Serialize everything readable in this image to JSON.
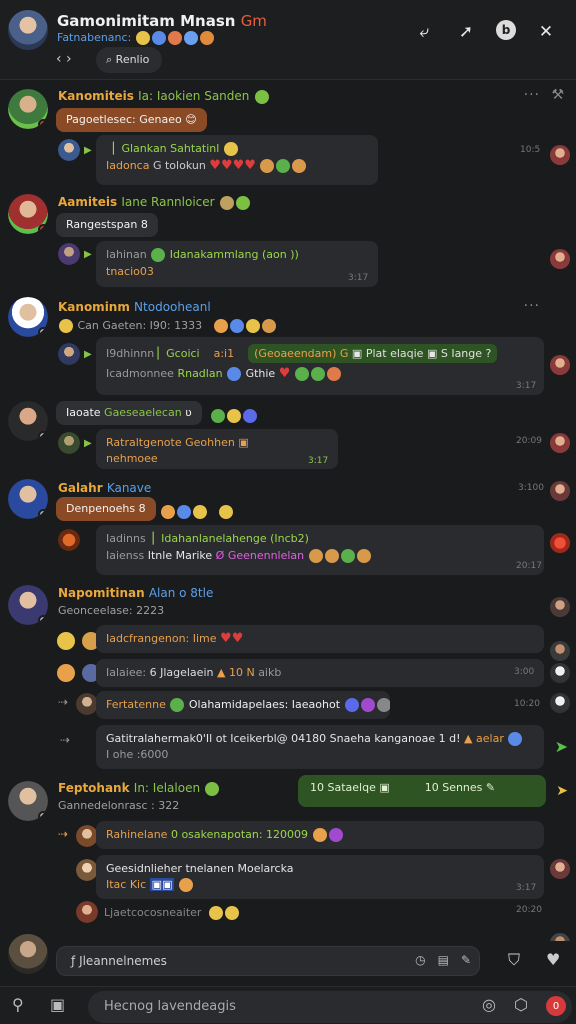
{
  "header": {
    "title": "Gamonimitam Mnasn",
    "title_tag": "Gm",
    "subtitle": "Fatnabenanc:",
    "search_label": "Renlio",
    "back_icon": "chevron-left-icon",
    "icons": [
      "share-icon",
      "forward-icon",
      "info-icon",
      "close-icon"
    ]
  },
  "messages": [
    {
      "name": "Kanomiteis",
      "name_extra": "Ia: Iaokien Sanden",
      "name_color": "#e8a83c",
      "pill": "Pagoetlesec: Genaeo",
      "pill_emoji": "😊",
      "bubble_line1": "Glankan Sahtatinl",
      "bubble_line2": "G tolokun",
      "bubble_prefix": "Iadonca",
      "time": "10:5"
    },
    {
      "name": "Aamiteis",
      "name_extra": "Iane Rannloicer",
      "name_color": "#e8a83c",
      "pill": "Rangestspan",
      "pill_emoji": "8",
      "bubble_prefix": "Iahinan",
      "bubble_line1": "Idanakammlang (aon ))",
      "bubble_line2": "tnacio03",
      "time": "3:17"
    },
    {
      "name": "Kanominm",
      "name_extra": "Ntodooheanl",
      "name_color": "#5aa0e8",
      "meta": "Can Gaeten: I90: 1333",
      "bubble_prefix": "I9dhinnn",
      "bubble_line1": "Gcoici",
      "bubble_mid": "a:i1",
      "bubble_green": "(Geoaeendam) G",
      "bubble_tail": "Plat elaqie",
      "bubble_tail2": "S Iange ?",
      "bubble_line2_prefix": "Icadmonnee",
      "bubble_line2": "Rnadlan",
      "bubble_line2b": "Gthie",
      "time": "3:17"
    },
    {
      "name": "Iaoate",
      "name_extra": "Gaeseaelecan",
      "name_color": "#d8d8d8",
      "bubble_line1": "Ratraltgenote Geohhen",
      "bubble_line2": "nehmoee",
      "time": "3:17",
      "time2": "20:09"
    },
    {
      "name": "Galahr",
      "name_extra": "Kanave",
      "name_color": "#e8a83c",
      "pill": "Denpenoehs",
      "pill_emoji": "8",
      "bubble_prefix": "Iadinns",
      "bubble_line1": "Idahanlanelahenge (Incb2)",
      "bubble_line2_prefix": "Iaienss",
      "bubble_line2": "Itnle Marike",
      "bubble_line2b": "Geenennlelan",
      "time": "20:17",
      "time2": "3:100"
    },
    {
      "name": "Napomitinan",
      "name_extra": "Alan o 8tle",
      "name_color": "#e8a83c",
      "meta": "Geonceelase: 2223",
      "row1": "Iadcfrangenon: Iime",
      "row2_prefix": "Ialaiee:",
      "row2": "6 Jlagelaein",
      "row2_mid": "10 N",
      "row2_tail": "aikb",
      "row3": "Fertatenne",
      "row3_mid": "Olahamidapelaes: Iaeaohot",
      "row4": "Gatitralahermak0'Il ot Iceikerbl@ 04180 Snaeha kanganoae 1 d!",
      "row4_tail": "aelar",
      "row4_line2": "I ohe :6000",
      "time_a": "3:00",
      "time_b": "10:20"
    },
    {
      "name": "Feptohank",
      "name_extra": "In: Ielaloen",
      "name_color": "#e8a83c",
      "meta": "Gannedelonrasc : 322",
      "green_left": "10 Sataelqe",
      "green_right": "10 Sennes",
      "row1_prefix": "Rahinelane",
      "row1": "0 osakenapotan: 120009",
      "bubble_line1": "Geesidnlieher tnelanen Moelarcka",
      "bubble_line2": "Itac Kic",
      "time": "3:17",
      "row3": "Ljaetcocosneaiter",
      "time2": "20:20"
    }
  ],
  "composer": {
    "placeholder": "Jleannelnemes",
    "icons": [
      "clock-icon",
      "attach-icon",
      "emoji-icon"
    ]
  },
  "bottom_bar": {
    "input_placeholder": "Hecnog lavendeagis",
    "badge": "0"
  }
}
